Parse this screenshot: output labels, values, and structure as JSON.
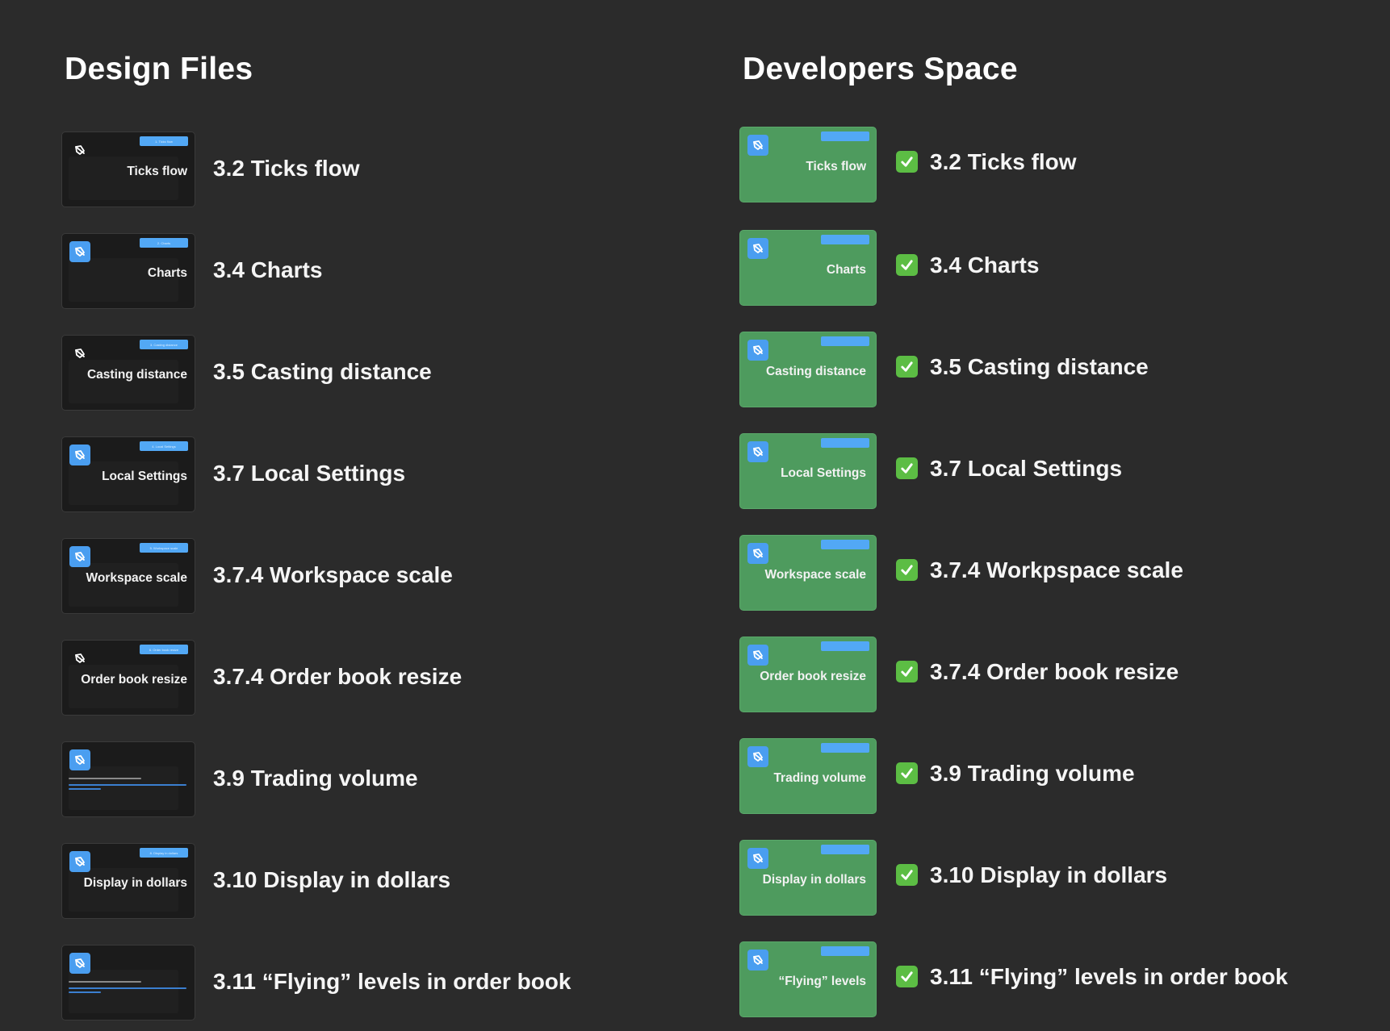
{
  "left": {
    "title": "Design Files",
    "items": [
      {
        "thumb_label": "Ticks flow",
        "title": "3.2 Ticks flow",
        "badge_style": "plain",
        "tag": "1. Ticks flow"
      },
      {
        "thumb_label": "Charts",
        "title": "3.4 Charts",
        "badge_style": "blue",
        "tag": "2. Charts"
      },
      {
        "thumb_label": "Casting distance",
        "title": "3.5 Casting distance",
        "badge_style": "plain",
        "tag": "3. Casting distance"
      },
      {
        "thumb_label": "Local Settings",
        "title": "3.7 Local Settings",
        "badge_style": "blue",
        "tag": "4. Local Settings"
      },
      {
        "thumb_label": "Workspace scale",
        "title": "3.7.4 Workspace scale",
        "badge_style": "blue",
        "tag": "5. Workspace scale"
      },
      {
        "thumb_label": "Order book resize",
        "title": "3.7.4 Order book resize",
        "badge_style": "plain",
        "tag": "6. Order book resize"
      },
      {
        "thumb_label": "",
        "title": "3.9 Trading volume",
        "badge_style": "blue",
        "tag": ""
      },
      {
        "thumb_label": "Display in dollars",
        "title": "3.10 Display in dollars",
        "badge_style": "blue",
        "tag": "8. Display in dollars"
      },
      {
        "thumb_label": "",
        "title": "3.11 “Flying” levels in order book",
        "badge_style": "blue",
        "tag": ""
      }
    ]
  },
  "right": {
    "title": "Developers Space",
    "items": [
      {
        "thumb_label": "Ticks flow",
        "title": "3.2 Ticks flow",
        "status": "done"
      },
      {
        "thumb_label": "Charts",
        "title": "3.4 Charts",
        "status": "done"
      },
      {
        "thumb_label": "Casting distance",
        "title": "3.5 Casting distance",
        "status": "done"
      },
      {
        "thumb_label": "Local Settings",
        "title": "3.7 Local Settings",
        "status": "done"
      },
      {
        "thumb_label": "Workspace scale",
        "title": "3.7.4 Workpspace scale",
        "status": "done"
      },
      {
        "thumb_label": "Order book resize",
        "title": "3.7.4 Order book resize",
        "status": "done"
      },
      {
        "thumb_label": "Trading volume",
        "title": "3.9 Trading volume",
        "status": "done"
      },
      {
        "thumb_label": "Display in dollars",
        "title": "3.10 Display in dollars",
        "status": "done"
      },
      {
        "thumb_label": "“Flying” levels",
        "title": "3.11 “Flying” levels in order book",
        "status": "done"
      }
    ]
  },
  "colors": {
    "background": "#2b2b2b",
    "thumb_dark": "#1b1b1b",
    "thumb_green": "#4e9b5e",
    "accent_blue": "#4a9ef0",
    "check_green": "#5cbd44"
  },
  "icons": {
    "badge": "figma-logo-icon",
    "check": "check-mark-icon"
  }
}
